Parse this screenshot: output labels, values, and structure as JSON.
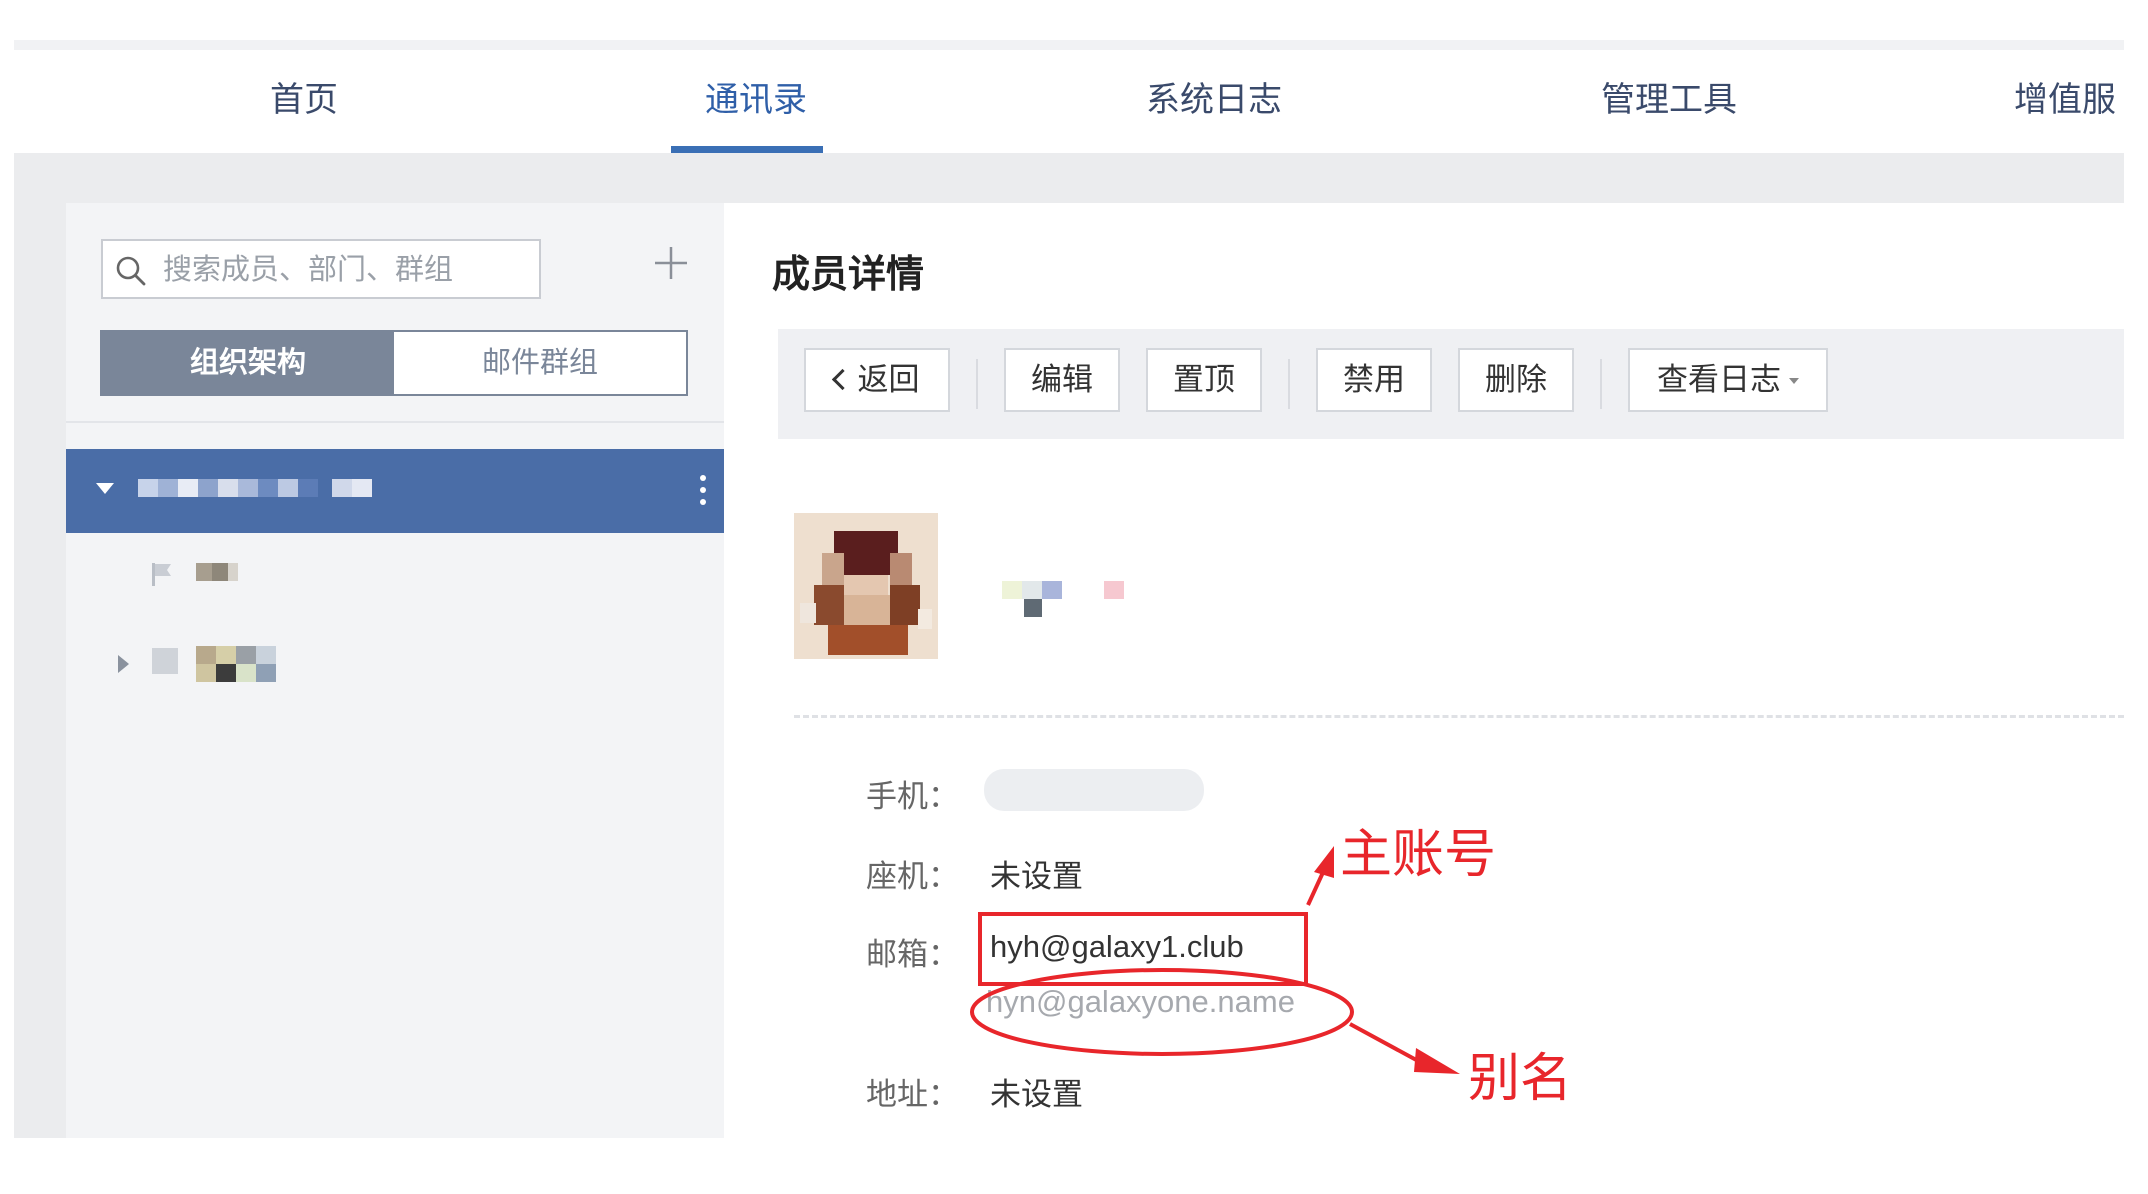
{
  "nav": {
    "tabs": [
      {
        "label": "首页"
      },
      {
        "label": "通讯录"
      },
      {
        "label": "系统日志"
      },
      {
        "label": "管理工具"
      },
      {
        "label": "增值服"
      }
    ],
    "active_index": 1
  },
  "sidebar": {
    "search_placeholder": "搜索成员、部门、群组",
    "segments": [
      {
        "label": "组织架构",
        "active": true
      },
      {
        "label": "邮件群组",
        "active": false
      }
    ]
  },
  "detail": {
    "title": "成员详情",
    "toolbar": {
      "back": "返回",
      "edit": "编辑",
      "pin": "置顶",
      "disable": "禁用",
      "delete": "删除",
      "view_log": "查看日志"
    },
    "fields": {
      "phone_label": "手机：",
      "landline_label": "座机：",
      "landline_value": "未设置",
      "email_label": "邮箱：",
      "email_primary": "hyh@galaxy1.club",
      "email_alias": "hyn@galaxyone.name",
      "address_label": "地址：",
      "address_value": "未设置"
    }
  },
  "annotations": {
    "primary_label": "主账号",
    "alias_label": "别名"
  },
  "colors": {
    "accent": "#3a6fb5",
    "tree_selected": "#4a6da7",
    "segment_active": "#7a8699",
    "annotation_red": "#e8262b"
  }
}
